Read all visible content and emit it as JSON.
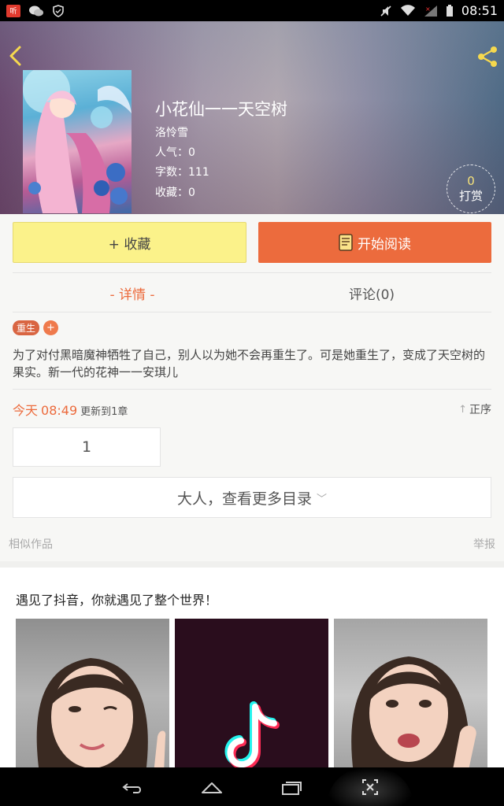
{
  "status_bar": {
    "app_badge": "听",
    "time": "08:51"
  },
  "book": {
    "title": "小花仙一一天空树",
    "author": "洛怜雪",
    "popularity": "人气：0",
    "word_count": "字数：111",
    "favorites": "收藏：0",
    "reward_count": "0",
    "reward_label": "打赏"
  },
  "actions": {
    "favorite_label": "+ 收藏",
    "read_label": "开始阅读"
  },
  "tabs": {
    "detail": "- 详情 -",
    "comments": "评论(0)"
  },
  "tags": {
    "genre": "重生",
    "add": "+"
  },
  "description": "为了对付黑暗魔神牺牲了自己，别人以为她不会再重生了。可是她重生了，变成了天空树的果实。新一代的花神一一安琪儿",
  "update": {
    "day": "今天",
    "time": "08:49",
    "text": "更新到1章",
    "sort_label": "正序"
  },
  "chapters": [
    "1"
  ],
  "more_toc_label": "大人，查看更多目录",
  "similar_label": "相似作品",
  "report_label": "举报",
  "ad": {
    "title": "遇见了抖音，你就遇见了整个世界！"
  },
  "colors": {
    "accent": "#ec6b3d",
    "fav_button": "#fbf28a"
  }
}
